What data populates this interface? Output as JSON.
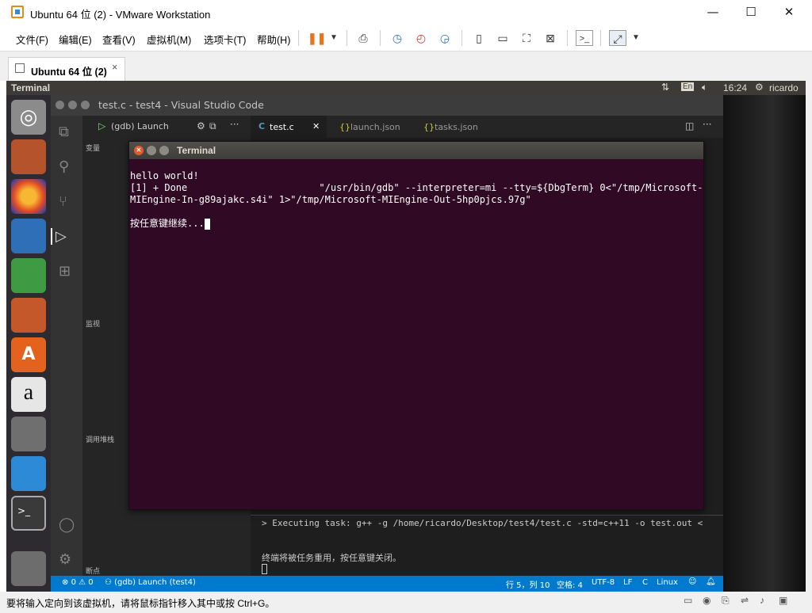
{
  "window": {
    "title": "Ubuntu 64 位 (2) - VMware Workstation"
  },
  "menu": [
    "文件(F)",
    "编辑(E)",
    "查看(V)",
    "虚拟机(M)",
    "选项卡(T)",
    "帮助(H)"
  ],
  "vm_tab": {
    "label": "Ubuntu 64 位 (2)",
    "close": "×"
  },
  "ubuntu": {
    "app_name": "Terminal",
    "kbd": "En",
    "time": "16:24",
    "user": "ricardo"
  },
  "vscode": {
    "title": "test.c - test4 - Visual Studio Code",
    "debug_config": "(gdb) Launch",
    "tabs": [
      {
        "label": "test.c",
        "icon": "C"
      },
      {
        "label": "launch.json",
        "icon": "{}"
      },
      {
        "label": "tasks.json",
        "icon": "{}"
      }
    ],
    "sections": {
      "variables": "变量",
      "watch": "监视",
      "callstack": "调用堆栈",
      "breakpoints": "断点"
    },
    "panel_lines": [
      "> Executing task: g++ -g /home/ricardo/Desktop/test4/test.c -std=c++11 -o test.out <",
      "终端将被任务重用，按任意键关闭。"
    ],
    "status": {
      "errors": "0",
      "warnings": "0",
      "debug": "(gdb) Launch (test4)",
      "pos": "行 5，列 10",
      "spaces": "空格: 4",
      "encoding": "UTF-8",
      "eol": "LF",
      "lang": "C",
      "platform": "Linux"
    }
  },
  "terminal": {
    "title": "Terminal",
    "lines": [
      "hello world!",
      "[1] + Done                       \"/usr/bin/gdb\" --interpreter=mi --tty=${DbgTerm} 0<\"/tmp/Microsoft-",
      "MIEngine-In-g89ajakc.s4i\" 1>\"/tmp/Microsoft-MIEngine-Out-5hp0pjcs.97g\"",
      "",
      "按任意键继续..."
    ]
  },
  "host_status": "要将输入定向到该虚拟机，请将鼠标指针移入其中或按 Ctrl+G。",
  "colors": {
    "terminal_bg": "#300a24",
    "vscode_status": "#007acc",
    "launcher": "#2e2b30"
  }
}
